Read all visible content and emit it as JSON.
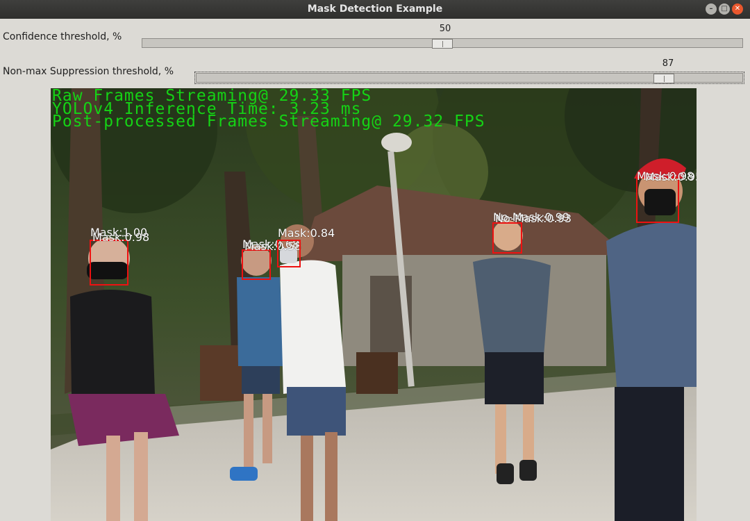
{
  "window": {
    "title": "Mask Detection Example"
  },
  "controls": {
    "confidence": {
      "label": "Confidence threshold, %",
      "value": "50",
      "level": 0.5
    },
    "nms": {
      "label": "Non-max Suppression threshold, %",
      "value": "87",
      "level": 0.87
    }
  },
  "overlay": {
    "raw_fps": "Raw Frames Streaming@ 29.33 FPS",
    "inference": "YOLOv4 Inference Time: 3.23 ms",
    "post_fps": "Post-processed Frames Streaming@ 29.32 FPS"
  },
  "detections": [
    {
      "label": "Mask:1.00",
      "label2": "Mask:0.98"
    },
    {
      "label": "Mask:0.68",
      "label2": "Mask:0.58"
    },
    {
      "label": "Mask:0.84",
      "label2": ""
    },
    {
      "label": "No-Mask:0.99",
      "label2": "No-Mask:0.93"
    },
    {
      "label": "Mask:0.98",
      "label2": "Mask:0.95"
    }
  ],
  "colors": {
    "box": "#ee1111",
    "overlay_text": "#15d315"
  }
}
